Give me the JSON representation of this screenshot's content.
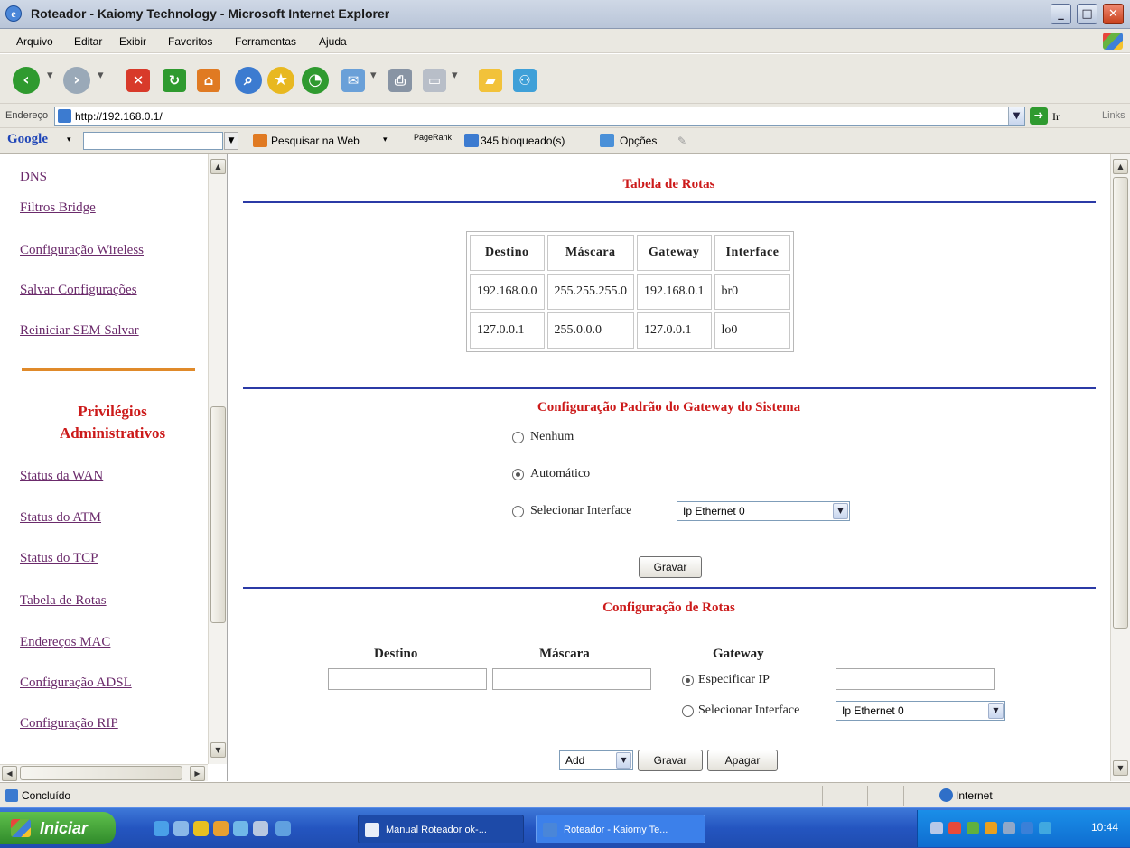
{
  "window": {
    "title": "Roteador - Kaiomy Technology - Microsoft Internet Explorer",
    "controls": [
      "_",
      "□",
      "✕"
    ]
  },
  "menu": [
    "Arquivo",
    "Editar",
    "Exibir",
    "Favoritos",
    "Ferramentas",
    "Ajuda"
  ],
  "address": {
    "label": "Endereço",
    "url": "http://192.168.0.1/",
    "go": "Ir",
    "links": "Links"
  },
  "googlebar": {
    "logo": "Google",
    "search_web": "Pesquisar na Web",
    "pagerank": "PageRank",
    "blocked": "345 bloqueado(s)",
    "options": "Opções"
  },
  "sidebar": {
    "top_links": [
      "DNS",
      "Filtros Bridge",
      "Configuração Wireless",
      "Salvar Configurações",
      "Reiniciar SEM Salvar"
    ],
    "section_heading_line1": "Privilégios",
    "section_heading_line2": "Administrativos",
    "admin_links": [
      "Status da WAN",
      "Status do ATM",
      "Status do TCP",
      "Tabela de Rotas",
      "Endereços MAC",
      "Configuração ADSL",
      "Configuração RIP"
    ]
  },
  "route_table": {
    "title": "Tabela de Rotas",
    "headers": [
      "Destino",
      "Máscara",
      "Gateway",
      "Interface"
    ],
    "rows": [
      [
        "192.168.0.0",
        "255.255.255.0",
        "192.168.0.1",
        "br0"
      ],
      [
        "127.0.0.1",
        "255.0.0.0",
        "127.0.0.1",
        "lo0"
      ]
    ]
  },
  "default_gateway": {
    "title": "Configuração Padrão do Gateway do Sistema",
    "options": [
      "Nenhum",
      "Automático",
      "Selecionar Interface"
    ],
    "selected_option": "Automático",
    "interface_value": "Ip Ethernet 0",
    "save_label": "Gravar"
  },
  "route_config": {
    "title": "Configuração de Rotas",
    "col_destino": "Destino",
    "col_mascara": "Máscara",
    "col_gateway": "Gateway",
    "opt_specify_ip": "Especificar IP",
    "opt_select_interface": "Selecionar Interface",
    "selected_option": "Especificar IP",
    "interface_value": "Ip Ethernet 0",
    "action_value": "Add",
    "save_label": "Gravar",
    "delete_label": "Apagar"
  },
  "status": {
    "text": "Concluído",
    "zone": "Internet"
  },
  "taskbar": {
    "start": "Iniciar",
    "tasks": [
      "Manual Roteador ok-...",
      "Roteador - Kaiomy Te..."
    ],
    "clock": "10:44"
  },
  "colors": {
    "section_title": "#cc1a1a",
    "rule": "#2b3aa6",
    "nav_link": "#6b2a6b",
    "nav_separator": "#e08a2a"
  }
}
